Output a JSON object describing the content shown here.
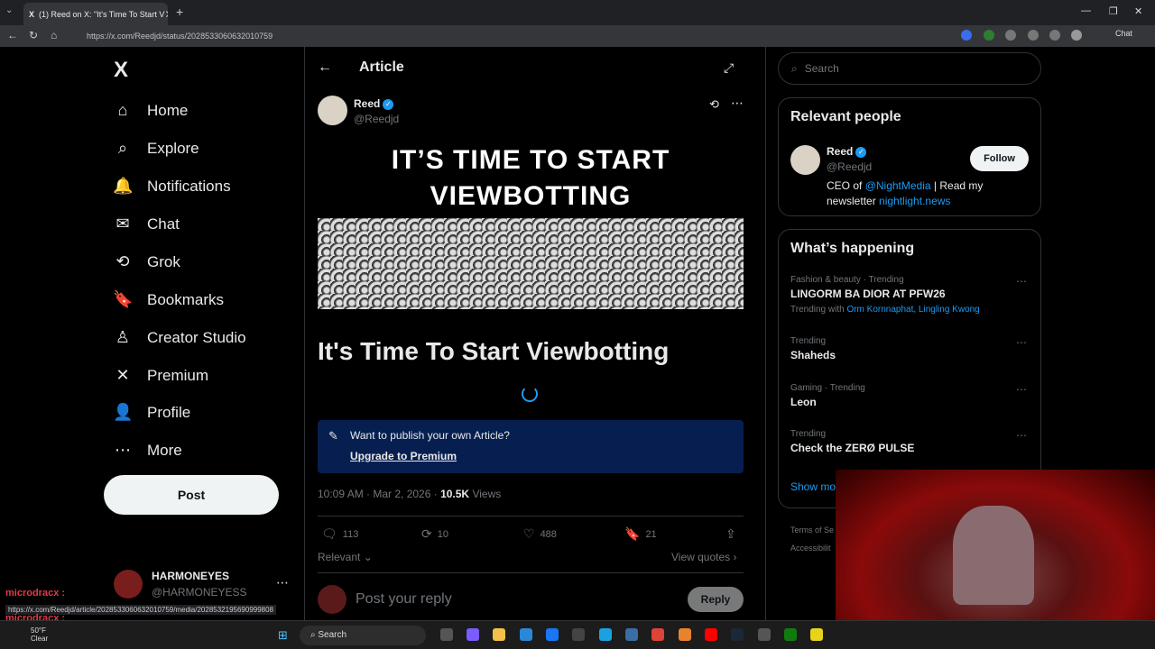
{
  "browser": {
    "tab_title": "(1) Reed on X: \"It's Time To Start V",
    "url": "https://x.com/Reedjd/status/2028533060632010759",
    "chat_label": "Chat"
  },
  "sidebar": {
    "logo": "X",
    "items": [
      {
        "label": "Home",
        "icon": "⌂"
      },
      {
        "label": "Explore",
        "icon": "⌕"
      },
      {
        "label": "Notifications",
        "icon": "🔔"
      },
      {
        "label": "Chat",
        "icon": "✉"
      },
      {
        "label": "Grok",
        "icon": "⟲"
      },
      {
        "label": "Bookmarks",
        "icon": "🔖"
      },
      {
        "label": "Creator Studio",
        "icon": "♙"
      },
      {
        "label": "Premium",
        "icon": "✕"
      },
      {
        "label": "Profile",
        "icon": "👤"
      },
      {
        "label": "More",
        "icon": "⋯"
      }
    ],
    "post_button": "Post",
    "account": {
      "name": "HARMONEYES",
      "handle": "@HARMONEYESS"
    }
  },
  "article": {
    "header": "Article",
    "author_name": "Reed",
    "author_handle": "@Reedjd",
    "hero_text": "IT’S TIME TO START VIEWBOTTING",
    "title": "It's Time To Start Viewbotting",
    "promo_question": "Want to publish your own Article?",
    "promo_link": "Upgrade to Premium",
    "time": "10:09 AM · Mar 2, 2026 · ",
    "views_count": "10.5K",
    "views_label": " Views",
    "stats": {
      "replies": "113",
      "reposts": "10",
      "likes": "488",
      "bookmarks": "21"
    },
    "sort": "Relevant",
    "view_quotes": "View quotes",
    "reply_placeholder": "Post your reply",
    "reply_button": "Reply"
  },
  "right": {
    "search_placeholder": "Search",
    "relevant_heading": "Relevant people",
    "person": {
      "name": "Reed",
      "handle": "@Reedjd",
      "follow": "Follow",
      "bio_1": "CEO of ",
      "bio_link1": "@NightMedia",
      "bio_2": " | Read my newsletter ",
      "bio_link2": "nightlight.news"
    },
    "happening_heading": "What’s happening",
    "trends": [
      {
        "context": "Fashion & beauty · Trending",
        "title": "LINGORM BA DIOR AT PFW26",
        "with_label": "Trending with ",
        "with_links": "Orm Kornnaphat, Lingling Kwong"
      },
      {
        "context": "Trending",
        "title": "Shaheds"
      },
      {
        "context": "Gaming · Trending",
        "title": "Leon"
      },
      {
        "context": "Trending",
        "title": "Check the ZERØ PULSE"
      }
    ],
    "show_more": "Show mo",
    "terms": "Terms of Se",
    "accessibility": "Accessibilit"
  },
  "overlay": {
    "chat_user": "microdracx :",
    "chat_user2": "microdracx :",
    "status_url": "https://x.com/Reedjd/article/2028533060632010759/media/2028532195690999808"
  },
  "taskbar": {
    "temp": "50°F",
    "weather": "Clear",
    "search": "Search"
  }
}
